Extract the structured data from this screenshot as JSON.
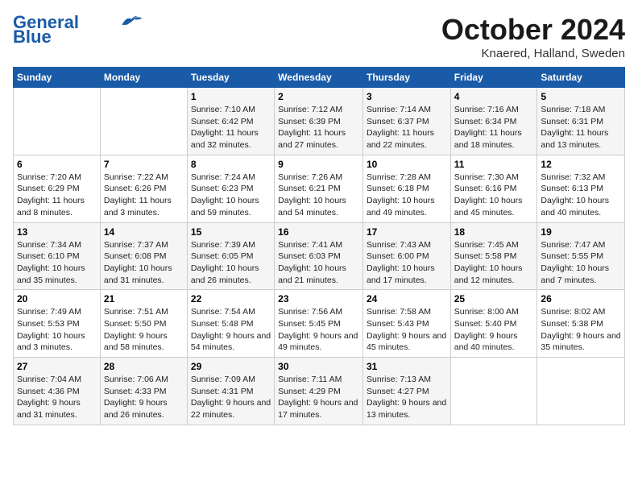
{
  "header": {
    "logo_line1": "General",
    "logo_line2": "Blue",
    "month": "October 2024",
    "location": "Knaered, Halland, Sweden"
  },
  "days_of_week": [
    "Sunday",
    "Monday",
    "Tuesday",
    "Wednesday",
    "Thursday",
    "Friday",
    "Saturday"
  ],
  "weeks": [
    [
      {
        "num": "",
        "info": ""
      },
      {
        "num": "",
        "info": ""
      },
      {
        "num": "1",
        "info": "Sunrise: 7:10 AM\nSunset: 6:42 PM\nDaylight: 11 hours and 32 minutes."
      },
      {
        "num": "2",
        "info": "Sunrise: 7:12 AM\nSunset: 6:39 PM\nDaylight: 11 hours and 27 minutes."
      },
      {
        "num": "3",
        "info": "Sunrise: 7:14 AM\nSunset: 6:37 PM\nDaylight: 11 hours and 22 minutes."
      },
      {
        "num": "4",
        "info": "Sunrise: 7:16 AM\nSunset: 6:34 PM\nDaylight: 11 hours and 18 minutes."
      },
      {
        "num": "5",
        "info": "Sunrise: 7:18 AM\nSunset: 6:31 PM\nDaylight: 11 hours and 13 minutes."
      }
    ],
    [
      {
        "num": "6",
        "info": "Sunrise: 7:20 AM\nSunset: 6:29 PM\nDaylight: 11 hours and 8 minutes."
      },
      {
        "num": "7",
        "info": "Sunrise: 7:22 AM\nSunset: 6:26 PM\nDaylight: 11 hours and 3 minutes."
      },
      {
        "num": "8",
        "info": "Sunrise: 7:24 AM\nSunset: 6:23 PM\nDaylight: 10 hours and 59 minutes."
      },
      {
        "num": "9",
        "info": "Sunrise: 7:26 AM\nSunset: 6:21 PM\nDaylight: 10 hours and 54 minutes."
      },
      {
        "num": "10",
        "info": "Sunrise: 7:28 AM\nSunset: 6:18 PM\nDaylight: 10 hours and 49 minutes."
      },
      {
        "num": "11",
        "info": "Sunrise: 7:30 AM\nSunset: 6:16 PM\nDaylight: 10 hours and 45 minutes."
      },
      {
        "num": "12",
        "info": "Sunrise: 7:32 AM\nSunset: 6:13 PM\nDaylight: 10 hours and 40 minutes."
      }
    ],
    [
      {
        "num": "13",
        "info": "Sunrise: 7:34 AM\nSunset: 6:10 PM\nDaylight: 10 hours and 35 minutes."
      },
      {
        "num": "14",
        "info": "Sunrise: 7:37 AM\nSunset: 6:08 PM\nDaylight: 10 hours and 31 minutes."
      },
      {
        "num": "15",
        "info": "Sunrise: 7:39 AM\nSunset: 6:05 PM\nDaylight: 10 hours and 26 minutes."
      },
      {
        "num": "16",
        "info": "Sunrise: 7:41 AM\nSunset: 6:03 PM\nDaylight: 10 hours and 21 minutes."
      },
      {
        "num": "17",
        "info": "Sunrise: 7:43 AM\nSunset: 6:00 PM\nDaylight: 10 hours and 17 minutes."
      },
      {
        "num": "18",
        "info": "Sunrise: 7:45 AM\nSunset: 5:58 PM\nDaylight: 10 hours and 12 minutes."
      },
      {
        "num": "19",
        "info": "Sunrise: 7:47 AM\nSunset: 5:55 PM\nDaylight: 10 hours and 7 minutes."
      }
    ],
    [
      {
        "num": "20",
        "info": "Sunrise: 7:49 AM\nSunset: 5:53 PM\nDaylight: 10 hours and 3 minutes."
      },
      {
        "num": "21",
        "info": "Sunrise: 7:51 AM\nSunset: 5:50 PM\nDaylight: 9 hours and 58 minutes."
      },
      {
        "num": "22",
        "info": "Sunrise: 7:54 AM\nSunset: 5:48 PM\nDaylight: 9 hours and 54 minutes."
      },
      {
        "num": "23",
        "info": "Sunrise: 7:56 AM\nSunset: 5:45 PM\nDaylight: 9 hours and 49 minutes."
      },
      {
        "num": "24",
        "info": "Sunrise: 7:58 AM\nSunset: 5:43 PM\nDaylight: 9 hours and 45 minutes."
      },
      {
        "num": "25",
        "info": "Sunrise: 8:00 AM\nSunset: 5:40 PM\nDaylight: 9 hours and 40 minutes."
      },
      {
        "num": "26",
        "info": "Sunrise: 8:02 AM\nSunset: 5:38 PM\nDaylight: 9 hours and 35 minutes."
      }
    ],
    [
      {
        "num": "27",
        "info": "Sunrise: 7:04 AM\nSunset: 4:36 PM\nDaylight: 9 hours and 31 minutes."
      },
      {
        "num": "28",
        "info": "Sunrise: 7:06 AM\nSunset: 4:33 PM\nDaylight: 9 hours and 26 minutes."
      },
      {
        "num": "29",
        "info": "Sunrise: 7:09 AM\nSunset: 4:31 PM\nDaylight: 9 hours and 22 minutes."
      },
      {
        "num": "30",
        "info": "Sunrise: 7:11 AM\nSunset: 4:29 PM\nDaylight: 9 hours and 17 minutes."
      },
      {
        "num": "31",
        "info": "Sunrise: 7:13 AM\nSunset: 4:27 PM\nDaylight: 9 hours and 13 minutes."
      },
      {
        "num": "",
        "info": ""
      },
      {
        "num": "",
        "info": ""
      }
    ]
  ]
}
